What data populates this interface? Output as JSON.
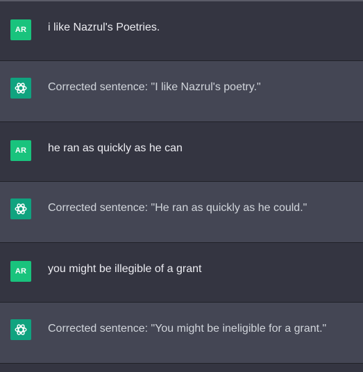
{
  "user_avatar_initials": "AR",
  "colors": {
    "user_bg": "#343541",
    "assistant_bg": "#444654",
    "user_avatar": "#19c37d",
    "assistant_avatar": "#10a37f",
    "user_text": "#ececf1",
    "assistant_text": "#d1d5db"
  },
  "messages": [
    {
      "role": "user",
      "avatar_icon": "user-initials-avatar",
      "text": "i like Nazrul's Poetries."
    },
    {
      "role": "assistant",
      "avatar_icon": "chatgpt-logo-icon",
      "text": "Corrected sentence: \"I like Nazrul's poetry.\""
    },
    {
      "role": "user",
      "avatar_icon": "user-initials-avatar",
      "text": "he ran as quickly as he can"
    },
    {
      "role": "assistant",
      "avatar_icon": "chatgpt-logo-icon",
      "text": "Corrected sentence: \"He ran as quickly as he could.\""
    },
    {
      "role": "user",
      "avatar_icon": "user-initials-avatar",
      "text": "you might be illegible of a grant"
    },
    {
      "role": "assistant",
      "avatar_icon": "chatgpt-logo-icon",
      "text": "Corrected sentence: \"You might be ineligible for a grant.\""
    }
  ]
}
